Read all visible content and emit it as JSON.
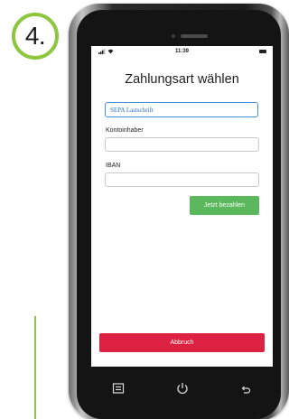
{
  "step": {
    "number": "4."
  },
  "status_bar": {
    "time": "11:39"
  },
  "screen": {
    "title": "Zahlungsart wählen",
    "payment_method": {
      "selected": "SEPA Lastschrift"
    },
    "account_holder": {
      "label": "Kontoinhaber",
      "value": ""
    },
    "iban": {
      "label": "IBAN",
      "value": ""
    },
    "pay_button": "Jetzt bezahlen",
    "cancel_button": "Abbruch"
  },
  "nav_bar": {
    "icons": [
      "menu-icon",
      "power-icon",
      "back-icon"
    ]
  },
  "colors": {
    "badge_green": "#8dc63f",
    "pay_green": "#5cb85c",
    "cancel_red": "#dc2142",
    "select_blue": "#4a90d9"
  }
}
